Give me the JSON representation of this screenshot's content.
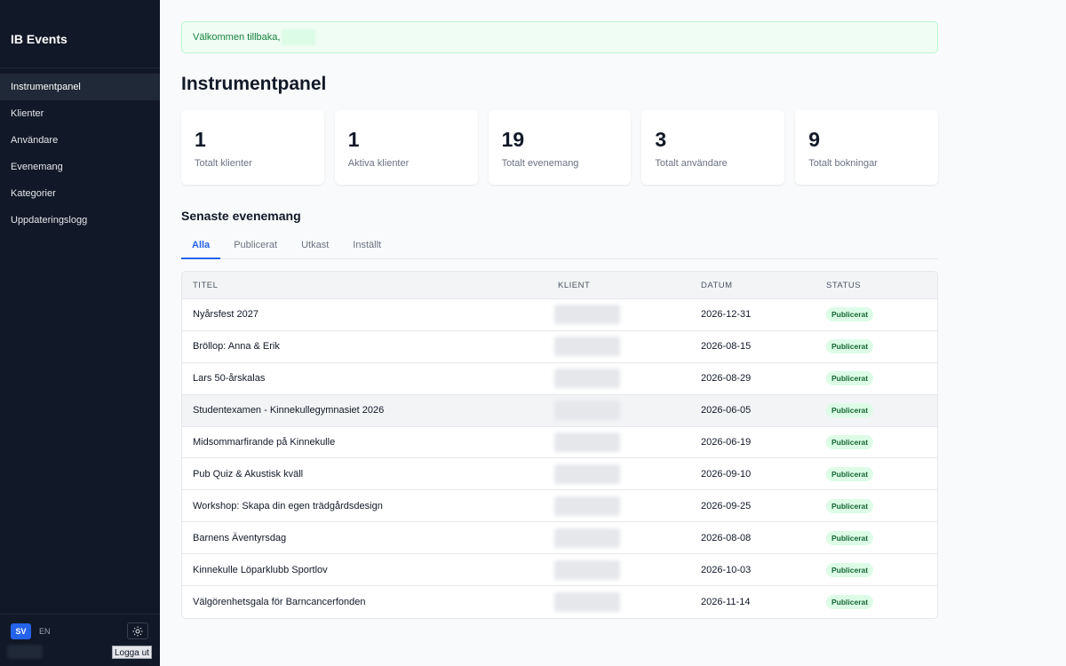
{
  "app": {
    "title": "IB Events"
  },
  "sidebar": {
    "items": [
      {
        "label": "Instrumentpanel"
      },
      {
        "label": "Klienter"
      },
      {
        "label": "Användare"
      },
      {
        "label": "Evenemang"
      },
      {
        "label": "Kategorier"
      },
      {
        "label": "Uppdateringslogg"
      }
    ],
    "active_index": 0,
    "lang_sv": "SV",
    "lang_en": "EN",
    "logout_label": "Logga ut",
    "theme_icon": "sun-icon"
  },
  "welcome": {
    "text": "Välkommen tillbaka,"
  },
  "page": {
    "title": "Instrumentpanel"
  },
  "stats": [
    {
      "value": "1",
      "label": "Totalt klienter"
    },
    {
      "value": "1",
      "label": "Aktiva klienter"
    },
    {
      "value": "19",
      "label": "Totalt evenemang"
    },
    {
      "value": "3",
      "label": "Totalt användare"
    },
    {
      "value": "9",
      "label": "Totalt bokningar"
    }
  ],
  "recent": {
    "title": "Senaste evenemang",
    "tabs": [
      {
        "label": "Alla"
      },
      {
        "label": "Publicerat"
      },
      {
        "label": "Utkast"
      },
      {
        "label": "Inställt"
      }
    ],
    "active_tab": 0,
    "columns": {
      "title": "TITEL",
      "client": "KLIENT",
      "date": "DATUM",
      "status": "STATUS"
    },
    "rows": [
      {
        "title": "Nyårsfest 2027",
        "date": "2026-12-31",
        "status": "Publicerat"
      },
      {
        "title": "Bröllop: Anna & Erik",
        "date": "2026-08-15",
        "status": "Publicerat"
      },
      {
        "title": "Lars 50-årskalas",
        "date": "2026-08-29",
        "status": "Publicerat"
      },
      {
        "title": "Studentexamen - Kinnekullegymnasiet 2026",
        "date": "2026-06-05",
        "status": "Publicerat"
      },
      {
        "title": "Midsommarfirande på Kinnekulle",
        "date": "2026-06-19",
        "status": "Publicerat"
      },
      {
        "title": "Pub Quiz & Akustisk kväll",
        "date": "2026-09-10",
        "status": "Publicerat"
      },
      {
        "title": "Workshop: Skapa din egen trädgårdsdesign",
        "date": "2026-09-25",
        "status": "Publicerat"
      },
      {
        "title": "Barnens Äventyrsdag",
        "date": "2026-08-08",
        "status": "Publicerat"
      },
      {
        "title": "Kinnekulle Löparklubb Sportlov",
        "date": "2026-10-03",
        "status": "Publicerat"
      },
      {
        "title": "Välgörenhetsgala för Barncancerfonden",
        "date": "2026-11-14",
        "status": "Publicerat"
      }
    ]
  },
  "colors": {
    "sidebar_bg": "#111827",
    "accent": "#2563eb",
    "success_bg": "#f0fdf4",
    "success_text": "#15803d",
    "badge_bg": "#dcfce7",
    "badge_text": "#166534"
  }
}
